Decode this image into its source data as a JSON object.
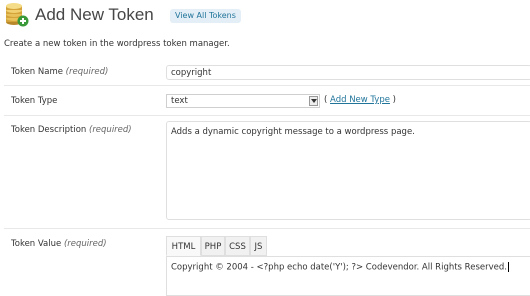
{
  "header": {
    "title": "Add New Token",
    "view_all_label": "View All Tokens",
    "logo_icon": "coins-plus-icon"
  },
  "intro": "Create a new token in the wordpress token manager.",
  "form": {
    "name": {
      "label": "Token Name",
      "required": "(required)",
      "value": "copyright"
    },
    "type": {
      "label": "Token Type",
      "selected": "text",
      "add_prefix": "(",
      "add_link": "Add New Type",
      "add_suffix": ")"
    },
    "description": {
      "label": "Token Description",
      "required": "(required)",
      "value": "Adds a dynamic copyright message to a wordpress page."
    },
    "value": {
      "label": "Token Value",
      "required": "(required)",
      "tabs": [
        "HTML",
        "PHP",
        "CSS",
        "JS"
      ],
      "active_tab": "HTML",
      "content": "Copyright © 2004 - <?php echo date('Y'); ?> Codevendor. All Rights Reserved."
    }
  },
  "colors": {
    "link": "#21759b",
    "button_bg": "#e4eef6",
    "border": "#dfdfdf"
  }
}
